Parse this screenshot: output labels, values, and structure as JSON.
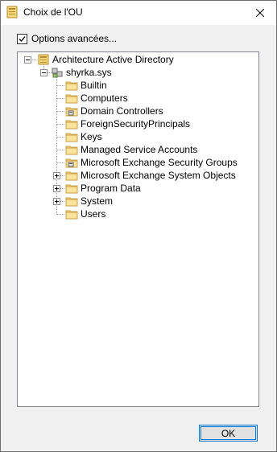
{
  "window": {
    "title": "Choix de l'OU"
  },
  "options": {
    "checked": true,
    "label": "Options avancées..."
  },
  "tree": {
    "root": {
      "label": "Architecture Active Directory",
      "icon": "ad-folder-icon",
      "expanded": true
    },
    "domain": {
      "label": "shyrka.sys",
      "icon": "domain-icon",
      "expanded": true
    },
    "children": [
      {
        "label": "Builtin",
        "icon": "folder-icon",
        "expandable": false
      },
      {
        "label": "Computers",
        "icon": "folder-icon",
        "expandable": false
      },
      {
        "label": "Domain Controllers",
        "icon": "ou-icon",
        "expandable": false
      },
      {
        "label": "ForeignSecurityPrincipals",
        "icon": "folder-icon",
        "expandable": false
      },
      {
        "label": "Keys",
        "icon": "folder-icon",
        "expandable": false
      },
      {
        "label": "Managed Service Accounts",
        "icon": "folder-icon",
        "expandable": false
      },
      {
        "label": "Microsoft Exchange Security Groups",
        "icon": "ou-icon",
        "expandable": false
      },
      {
        "label": "Microsoft Exchange System Objects",
        "icon": "folder-icon",
        "expandable": true
      },
      {
        "label": "Program Data",
        "icon": "folder-icon",
        "expandable": true
      },
      {
        "label": "System",
        "icon": "folder-icon",
        "expandable": true
      },
      {
        "label": "Users",
        "icon": "folder-icon",
        "expandable": false
      }
    ]
  },
  "buttons": {
    "ok": "OK"
  }
}
